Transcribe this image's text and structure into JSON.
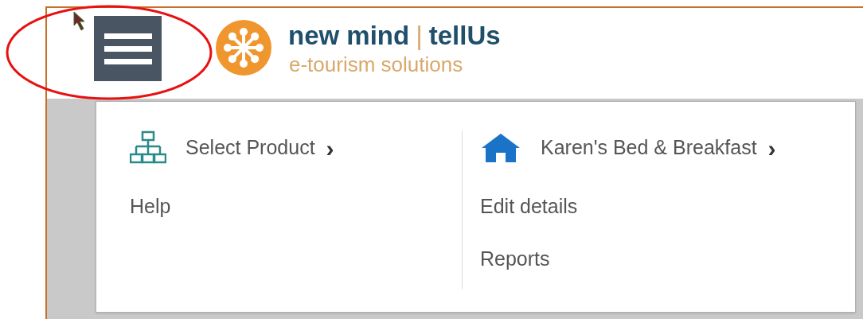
{
  "header": {
    "menu_button": {
      "selected": true
    },
    "logo": {
      "brand_left": "new mind",
      "separator": "|",
      "brand_right": "tellUs",
      "tagline": "e-tourism solutions"
    }
  },
  "menu": {
    "columns": [
      {
        "heading": {
          "label": "Select Product",
          "chevron": "›"
        },
        "items": [
          "Help"
        ]
      },
      {
        "heading": {
          "label": "Karen's Bed & Breakfast",
          "chevron": "›"
        },
        "items": [
          "Edit details",
          "Reports"
        ]
      }
    ]
  },
  "annotation": {
    "kind": "ellipse",
    "color": "#e81010"
  }
}
